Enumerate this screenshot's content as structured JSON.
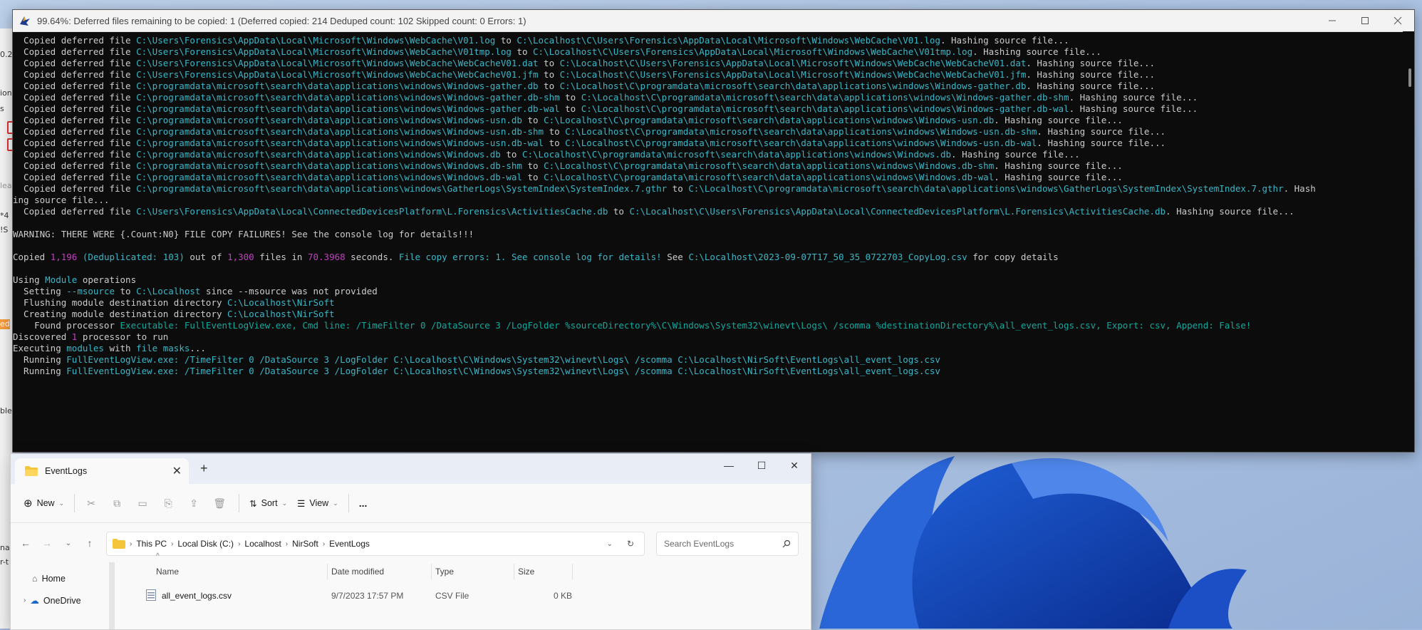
{
  "console": {
    "title": "99.64%: Deferred files remaining to be copied: 1 (Deferred copied: 214 Deduped count: 102 Skipped count: 0 Errors: 1)",
    "lines": [
      [
        [
          "w",
          "  Copied deferred file "
        ],
        [
          "c",
          "C:\\Users\\Forensics\\AppData\\Local\\Microsoft\\Windows\\WebCache\\V01.log"
        ],
        [
          "w",
          " to "
        ],
        [
          "c",
          "C:\\Localhost\\C\\Users\\Forensics\\AppData\\Local\\Microsoft\\Windows\\WebCache\\V01.log"
        ],
        [
          "w",
          ". Hashing source file..."
        ]
      ],
      [
        [
          "w",
          "  Copied deferred file "
        ],
        [
          "c",
          "C:\\Users\\Forensics\\AppData\\Local\\Microsoft\\Windows\\WebCache\\V01tmp.log"
        ],
        [
          "w",
          " to "
        ],
        [
          "c",
          "C:\\Localhost\\C\\Users\\Forensics\\AppData\\Local\\Microsoft\\Windows\\WebCache\\V01tmp.log"
        ],
        [
          "w",
          ". Hashing source file..."
        ]
      ],
      [
        [
          "w",
          "  Copied deferred file "
        ],
        [
          "c",
          "C:\\Users\\Forensics\\AppData\\Local\\Microsoft\\Windows\\WebCache\\WebCacheV01.dat"
        ],
        [
          "w",
          " to "
        ],
        [
          "c",
          "C:\\Localhost\\C\\Users\\Forensics\\AppData\\Local\\Microsoft\\Windows\\WebCache\\WebCacheV01.dat"
        ],
        [
          "w",
          ". Hashing source file..."
        ]
      ],
      [
        [
          "w",
          "  Copied deferred file "
        ],
        [
          "c",
          "C:\\Users\\Forensics\\AppData\\Local\\Microsoft\\Windows\\WebCache\\WebCacheV01.jfm"
        ],
        [
          "w",
          " to "
        ],
        [
          "c",
          "C:\\Localhost\\C\\Users\\Forensics\\AppData\\Local\\Microsoft\\Windows\\WebCache\\WebCacheV01.jfm"
        ],
        [
          "w",
          ". Hashing source file..."
        ]
      ],
      [
        [
          "w",
          "  Copied deferred file "
        ],
        [
          "c",
          "C:\\programdata\\microsoft\\search\\data\\applications\\windows\\Windows-gather.db"
        ],
        [
          "w",
          " to "
        ],
        [
          "c",
          "C:\\Localhost\\C\\programdata\\microsoft\\search\\data\\applications\\windows\\Windows-gather.db"
        ],
        [
          "w",
          ". Hashing source file..."
        ]
      ],
      [
        [
          "w",
          "  Copied deferred file "
        ],
        [
          "c",
          "C:\\programdata\\microsoft\\search\\data\\applications\\windows\\Windows-gather.db-shm"
        ],
        [
          "w",
          " to "
        ],
        [
          "c",
          "C:\\Localhost\\C\\programdata\\microsoft\\search\\data\\applications\\windows\\Windows-gather.db-shm"
        ],
        [
          "w",
          ". Hashing source file..."
        ]
      ],
      [
        [
          "w",
          "  Copied deferred file "
        ],
        [
          "c",
          "C:\\programdata\\microsoft\\search\\data\\applications\\windows\\Windows-gather.db-wal"
        ],
        [
          "w",
          " to "
        ],
        [
          "c",
          "C:\\Localhost\\C\\programdata\\microsoft\\search\\data\\applications\\windows\\Windows-gather.db-wal"
        ],
        [
          "w",
          ". Hashing source file..."
        ]
      ],
      [
        [
          "w",
          "  Copied deferred file "
        ],
        [
          "c",
          "C:\\programdata\\microsoft\\search\\data\\applications\\windows\\Windows-usn.db"
        ],
        [
          "w",
          " to "
        ],
        [
          "c",
          "C:\\Localhost\\C\\programdata\\microsoft\\search\\data\\applications\\windows\\Windows-usn.db"
        ],
        [
          "w",
          ". Hashing source file..."
        ]
      ],
      [
        [
          "w",
          "  Copied deferred file "
        ],
        [
          "c",
          "C:\\programdata\\microsoft\\search\\data\\applications\\windows\\Windows-usn.db-shm"
        ],
        [
          "w",
          " to "
        ],
        [
          "c",
          "C:\\Localhost\\C\\programdata\\microsoft\\search\\data\\applications\\windows\\Windows-usn.db-shm"
        ],
        [
          "w",
          ". Hashing source file..."
        ]
      ],
      [
        [
          "w",
          "  Copied deferred file "
        ],
        [
          "c",
          "C:\\programdata\\microsoft\\search\\data\\applications\\windows\\Windows-usn.db-wal"
        ],
        [
          "w",
          " to "
        ],
        [
          "c",
          "C:\\Localhost\\C\\programdata\\microsoft\\search\\data\\applications\\windows\\Windows-usn.db-wal"
        ],
        [
          "w",
          ". Hashing source file..."
        ]
      ],
      [
        [
          "w",
          "  Copied deferred file "
        ],
        [
          "c",
          "C:\\programdata\\microsoft\\search\\data\\applications\\windows\\Windows.db"
        ],
        [
          "w",
          " to "
        ],
        [
          "c",
          "C:\\Localhost\\C\\programdata\\microsoft\\search\\data\\applications\\windows\\Windows.db"
        ],
        [
          "w",
          ". Hashing source file..."
        ]
      ],
      [
        [
          "w",
          "  Copied deferred file "
        ],
        [
          "c",
          "C:\\programdata\\microsoft\\search\\data\\applications\\windows\\Windows.db-shm"
        ],
        [
          "w",
          " to "
        ],
        [
          "c",
          "C:\\Localhost\\C\\programdata\\microsoft\\search\\data\\applications\\windows\\Windows.db-shm"
        ],
        [
          "w",
          ". Hashing source file..."
        ]
      ],
      [
        [
          "w",
          "  Copied deferred file "
        ],
        [
          "c",
          "C:\\programdata\\microsoft\\search\\data\\applications\\windows\\Windows.db-wal"
        ],
        [
          "w",
          " to "
        ],
        [
          "c",
          "C:\\Localhost\\C\\programdata\\microsoft\\search\\data\\applications\\windows\\Windows.db-wal"
        ],
        [
          "w",
          ". Hashing source file..."
        ]
      ],
      [
        [
          "w",
          "  Copied deferred file "
        ],
        [
          "c",
          "C:\\programdata\\microsoft\\search\\data\\applications\\windows\\GatherLogs\\SystemIndex\\SystemIndex.7.gthr"
        ],
        [
          "w",
          " to "
        ],
        [
          "c",
          "C:\\Localhost\\C\\programdata\\microsoft\\search\\data\\applications\\windows\\GatherLogs\\SystemIndex\\SystemIndex.7.gthr"
        ],
        [
          "w",
          ". Hash"
        ]
      ],
      [
        [
          "w",
          "ing source file..."
        ]
      ],
      [
        [
          "w",
          "  Copied deferred file "
        ],
        [
          "c",
          "C:\\Users\\Forensics\\AppData\\Local\\ConnectedDevicesPlatform\\L.Forensics\\ActivitiesCache.db"
        ],
        [
          "w",
          " to "
        ],
        [
          "c",
          "C:\\Localhost\\C\\Users\\Forensics\\AppData\\Local\\ConnectedDevicesPlatform\\L.Forensics\\ActivitiesCache.db"
        ],
        [
          "w",
          ". Hashing source file..."
        ]
      ],
      [
        [
          "w",
          ""
        ]
      ],
      [
        [
          "w",
          "WARNING: THERE WERE {.Count:N0} FILE COPY FAILURES! See the console log for details!!!"
        ]
      ],
      [
        [
          "w",
          ""
        ]
      ],
      [
        [
          "w",
          "Copied "
        ],
        [
          "m",
          "1,196"
        ],
        [
          "c",
          " (Deduplicated: 103)"
        ],
        [
          "w",
          " out of "
        ],
        [
          "m",
          "1,300"
        ],
        [
          "w",
          " files in "
        ],
        [
          "m",
          "70.3968"
        ],
        [
          "w",
          " seconds. "
        ],
        [
          "c",
          "File copy errors: 1. See console log for details!"
        ],
        [
          "w",
          " See "
        ],
        [
          "c",
          "C:\\Localhost\\2023-09-07T17_50_35_0722703_CopyLog.csv"
        ],
        [
          "w",
          " for copy details"
        ]
      ],
      [
        [
          "w",
          ""
        ]
      ],
      [
        [
          "w",
          "Using "
        ],
        [
          "c",
          "Module"
        ],
        [
          "w",
          " operations"
        ]
      ],
      [
        [
          "w",
          "  Setting "
        ],
        [
          "c",
          "--msource"
        ],
        [
          "w",
          " to "
        ],
        [
          "c",
          "C:\\Localhost"
        ],
        [
          "w",
          " since --msource was not provided"
        ]
      ],
      [
        [
          "w",
          "  Flushing module destination directory "
        ],
        [
          "c",
          "C:\\Localhost\\NirSoft"
        ]
      ],
      [
        [
          "w",
          "  Creating module destination directory "
        ],
        [
          "c",
          "C:\\Localhost\\NirSoft"
        ]
      ],
      [
        [
          "w",
          "    Found processor "
        ],
        [
          "g",
          "Executable: FullEventLogView.exe, Cmd line: /TimeFilter 0 /DataSource 3 /LogFolder %sourceDirectory%\\C\\Windows\\System32\\winevt\\Logs\\ /scomma %destinationDirectory%\\all_event_logs.csv, Export: csv, Append: False!"
        ]
      ],
      [
        [
          "w",
          "Discovered "
        ],
        [
          "m",
          "1"
        ],
        [
          "w",
          " processor to run"
        ]
      ],
      [
        [
          "w",
          "Executing "
        ],
        [
          "c",
          "modules"
        ],
        [
          "w",
          " with "
        ],
        [
          "c",
          "file masks"
        ],
        [
          "w",
          "..."
        ]
      ],
      [
        [
          "w",
          "  Running "
        ],
        [
          "c",
          "FullEventLogView.exe: /TimeFilter 0 /DataSource 3 /LogFolder C:\\Localhost\\C\\Windows\\System32\\winevt\\Logs\\ /scomma C:\\Localhost\\NirSoft\\EventLogs\\all_event_logs.csv"
        ]
      ],
      [
        [
          "w",
          "  Running "
        ],
        [
          "c",
          "FullEventLogView.exe: /TimeFilter 0 /DataSource 3 /LogFolder C:\\Localhost\\C\\Windows\\System32\\winevt\\Logs\\ /scomma C:\\Localhost\\NirSoft\\EventLogs\\all_event_logs.csv"
        ]
      ]
    ],
    "colors": {
      "cyan": "#3ab7c8",
      "magenta": "#c040c0",
      "green": "#13a89e",
      "text": "#cccccc"
    }
  },
  "left_strip": {
    "fragments": [
      "0.2",
      "ions",
      "s",
      "lead",
      "*4",
      "!S",
      "ed",
      "ble",
      "nar",
      "r-t"
    ]
  },
  "explorer": {
    "tab_title": "EventLogs",
    "cmdbar": {
      "new_label": "New",
      "sort_label": "Sort",
      "view_label": "View",
      "more_label": "..."
    },
    "address": {
      "crumbs": [
        "This PC",
        "Local Disk (C:)",
        "Localhost",
        "NirSoft",
        "EventLogs"
      ]
    },
    "search_placeholder": "Search EventLogs",
    "nav": {
      "home": "Home",
      "onedrive": "OneDrive"
    },
    "columns": {
      "name": "Name",
      "date": "Date modified",
      "type": "Type",
      "size": "Size"
    },
    "files": [
      {
        "name": "all_event_logs.csv",
        "date": "9/7/2023 17:57 PM",
        "type": "CSV File",
        "size": "0 KB"
      }
    ]
  }
}
